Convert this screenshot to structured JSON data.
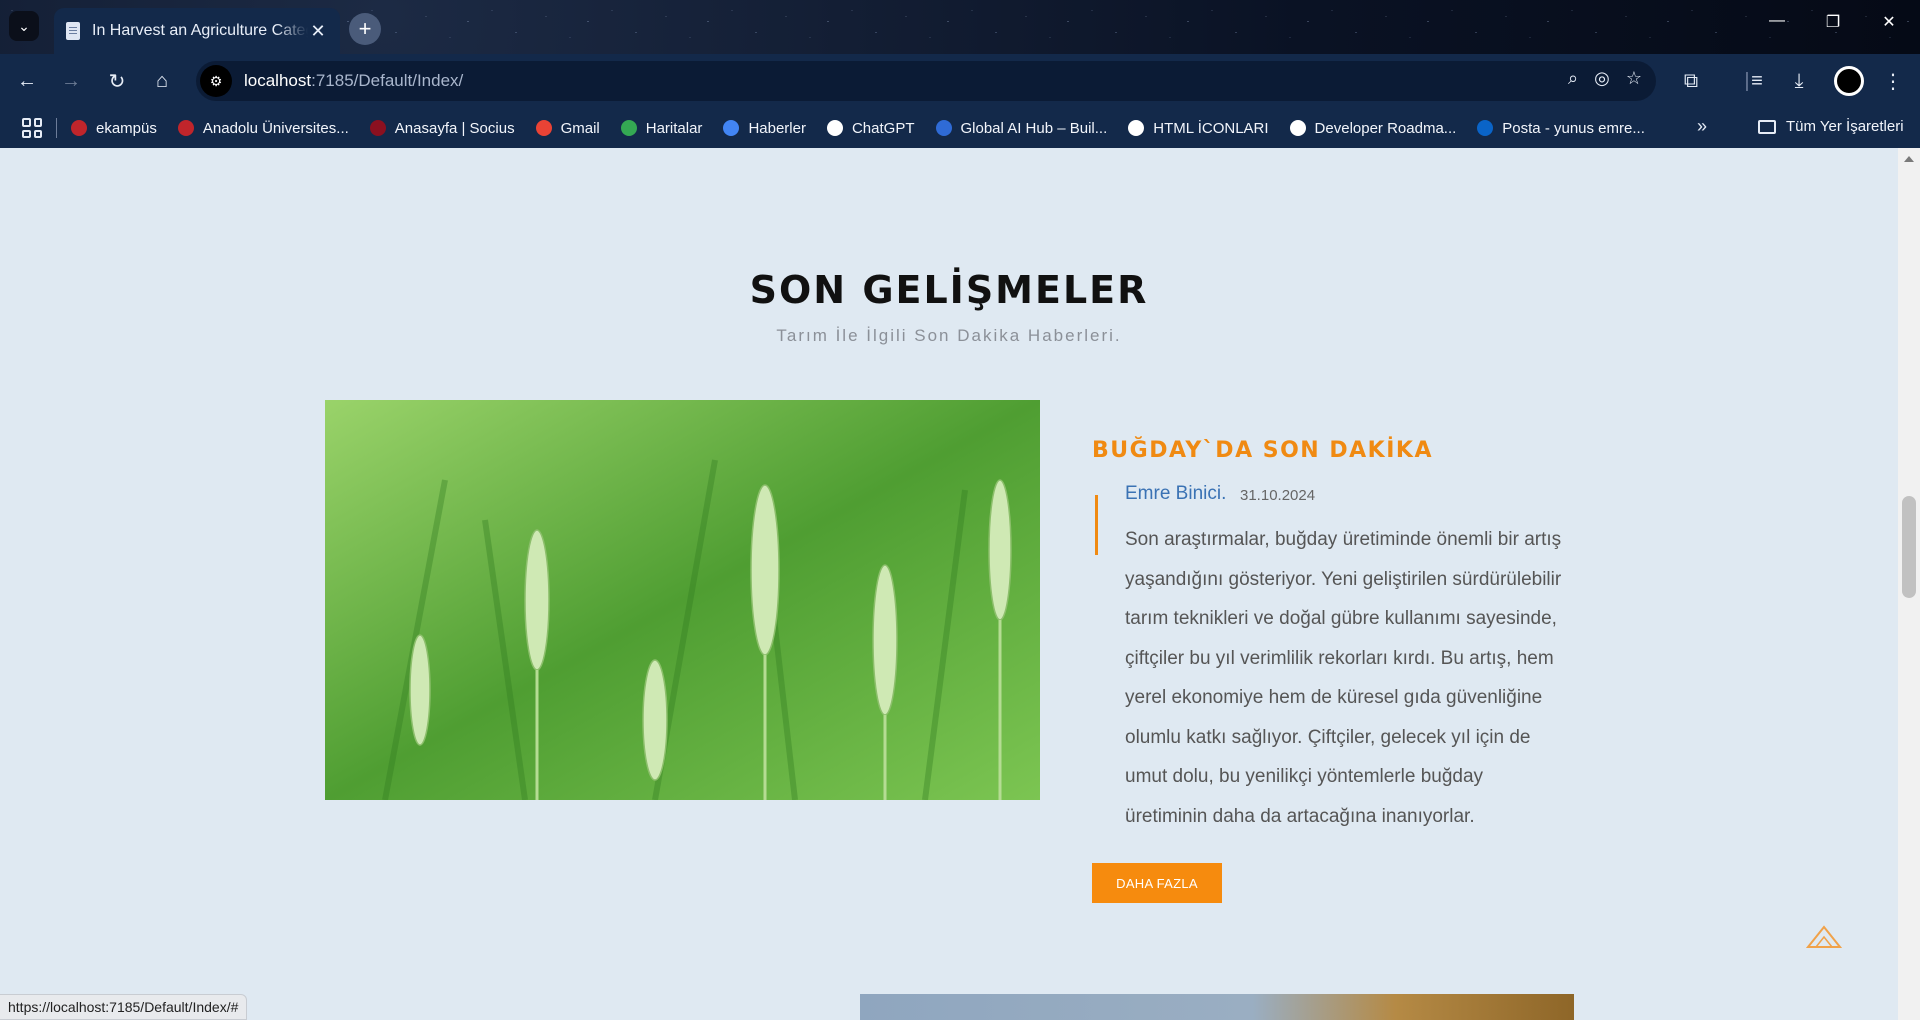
{
  "browser": {
    "tab_title": "In Harvest an Agriculture Category",
    "url_host": "localhost",
    "url_path": ":7185/Default/Index/",
    "bookmarks": [
      {
        "label": "ekampüs",
        "color": "#c0252b"
      },
      {
        "label": "Anadolu Üniversites...",
        "color": "#c0252b"
      },
      {
        "label": "Anasayfa | Socius",
        "color": "#8b1020"
      },
      {
        "label": "Gmail",
        "color": "#ea4335"
      },
      {
        "label": "Haritalar",
        "color": "#34a853"
      },
      {
        "label": "Haberler",
        "color": "#4285f4"
      },
      {
        "label": "ChatGPT",
        "color": "#ffffff"
      },
      {
        "label": "Global AI Hub – Buil...",
        "color": "#2f6bd6"
      },
      {
        "label": "HTML İCONLARI",
        "color": "#ffffff"
      },
      {
        "label": "Developer Roadma...",
        "color": "#ffffff"
      },
      {
        "label": "Posta - yunus emre...",
        "color": "#0a64c8"
      }
    ],
    "all_bookmarks_label": "Tüm Yer İşaretleri",
    "status_url": "https://localhost:7185/Default/Index/#"
  },
  "section": {
    "title": "SON GELİŞMELER",
    "subtitle": "Tarım İle İlgili Son Dakika Haberleri."
  },
  "article": {
    "title": "BUĞDAY`DA SON DAKİKA",
    "author": "Emre Binici.",
    "date": "31.10.2024",
    "body": "Son araştırmalar, buğday üretiminde önemli bir artış yaşandığını gösteriyor. Yeni geliştirilen sürdürülebilir tarım teknikleri ve doğal gübre kullanımı sayesinde, çiftçiler bu yıl verimlilik rekorları kırdı. Bu artış, hem yerel ekonomiye hem de küresel gıda güvenliğine olumlu katkı sağlıyor. Çiftçiler, gelecek yıl için de umut dolu, bu yenilikçi yöntemlerle buğday üretiminin daha da artacağına inanıyorlar.",
    "button_label": "DAHA FAZLA"
  },
  "colors": {
    "accent": "#f08a12",
    "author_link": "#3a72b4",
    "page_bg": "#dfe9f2"
  }
}
